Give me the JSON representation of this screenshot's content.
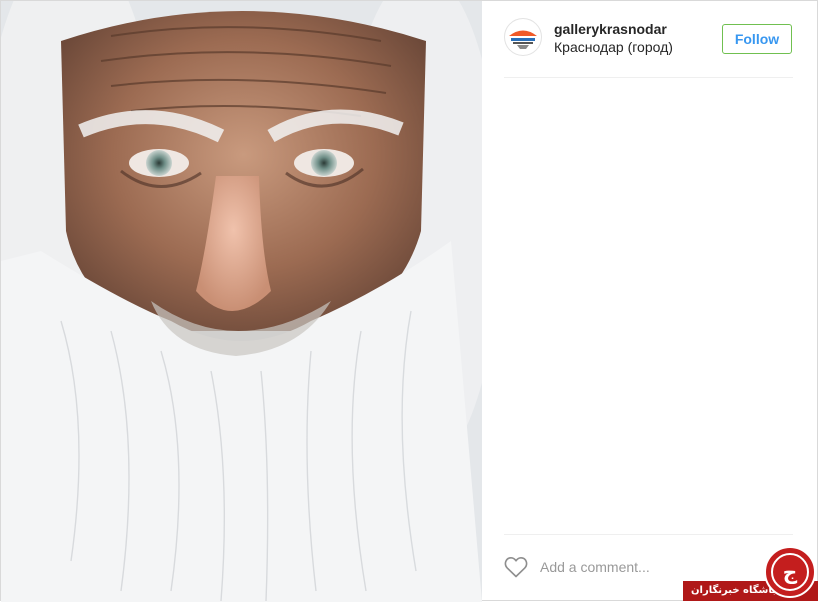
{
  "post": {
    "username": "gallerykrasnodar",
    "location": "Краснодар (город)",
    "follow_label": "Follow",
    "comment_placeholder": "Add a comment...",
    "photo_subject": "portrait of an old man with a long white beard"
  },
  "watermark": {
    "text": "باشگاه خبرنگاران",
    "logo_glyph": "ج"
  },
  "icons": {
    "like": "heart-outline-icon",
    "avatar": "gallery-logo-avatar"
  },
  "colors": {
    "follow_text": "#3897f0",
    "follow_border": "#70c050",
    "text": "#262626",
    "placeholder": "#999999",
    "watermark_red": "#b01818",
    "avatar_orange": "#f05a28"
  }
}
